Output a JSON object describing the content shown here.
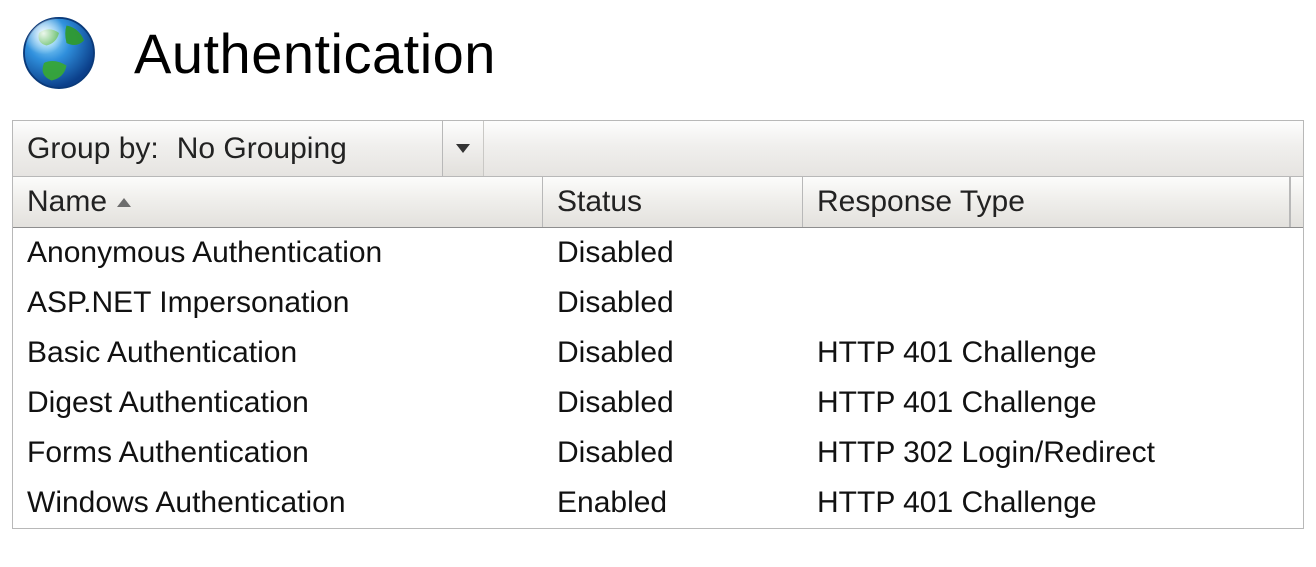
{
  "header": {
    "title": "Authentication",
    "icon": "globe-icon"
  },
  "toolbar": {
    "groupby_label": "Group by:",
    "groupby_value": "No Grouping"
  },
  "columns": {
    "name": "Name",
    "status": "Status",
    "response_type": "Response Type",
    "sort_column": "name",
    "sort_dir": "asc"
  },
  "rows": [
    {
      "name": "Anonymous Authentication",
      "status": "Disabled",
      "response_type": ""
    },
    {
      "name": "ASP.NET Impersonation",
      "status": "Disabled",
      "response_type": ""
    },
    {
      "name": "Basic Authentication",
      "status": "Disabled",
      "response_type": "HTTP 401 Challenge"
    },
    {
      "name": "Digest Authentication",
      "status": "Disabled",
      "response_type": "HTTP 401 Challenge"
    },
    {
      "name": "Forms Authentication",
      "status": "Disabled",
      "response_type": "HTTP 302 Login/Redirect"
    },
    {
      "name": "Windows Authentication",
      "status": "Enabled",
      "response_type": "HTTP 401 Challenge"
    }
  ]
}
